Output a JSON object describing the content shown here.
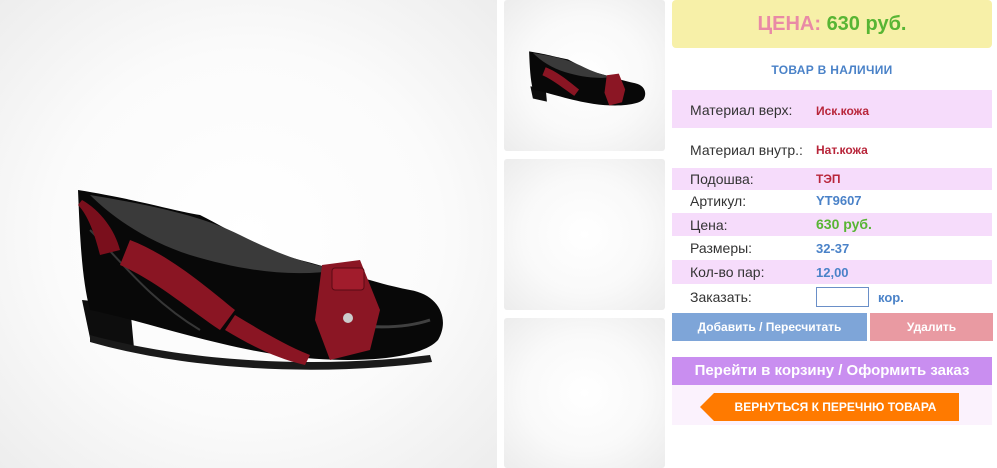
{
  "price_box": {
    "label": "ЦЕНА:",
    "value": "630 руб."
  },
  "stock_status": "ТОВАР В НАЛИЧИИ",
  "specs": [
    {
      "label": "Материал верх:",
      "value": "Иск.кожа"
    },
    {
      "label": "Материал внутр.:",
      "value": "Нат.кожа"
    },
    {
      "label": "Подошва:",
      "value": "ТЭП"
    },
    {
      "label": "Артикул:",
      "value": "YT9607"
    },
    {
      "label": "Цена:",
      "value": "630 руб."
    },
    {
      "label": "Размеры:",
      "value": "32-37"
    },
    {
      "label": "Кол-во пар:",
      "value": "12,00"
    }
  ],
  "order": {
    "label": "Заказать:",
    "quantity_value": "",
    "unit": "кор."
  },
  "buttons": {
    "add": "Добавить / Пересчитать",
    "delete": "Удалить",
    "cart": "Перейти в корзину / Оформить заказ",
    "back": "ВЕРНУТЬСЯ К ПЕРЕЧНЮ ТОВАРА"
  },
  "colors": {
    "price_label": "#e98aa6",
    "price_value": "#58b534",
    "accent_blue": "#4a82c8",
    "accent_red": "#b8253a",
    "cart_button": "#c98ef0",
    "back_button": "#ff7a00"
  }
}
